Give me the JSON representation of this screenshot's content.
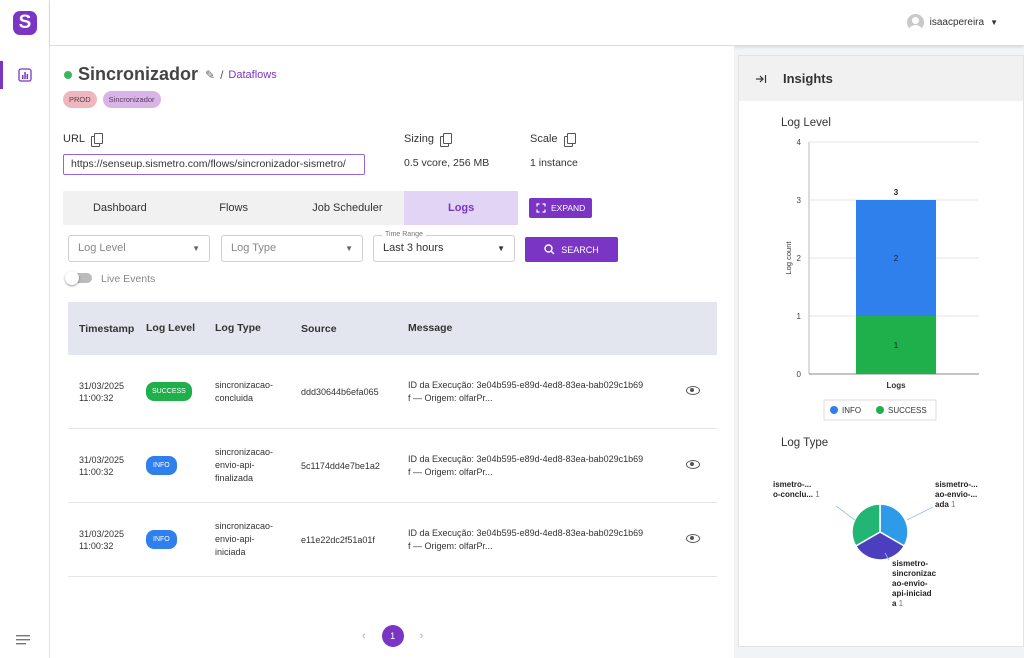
{
  "app": {
    "logo_letter": "S"
  },
  "topbar": {
    "user_name": "isaacpereira"
  },
  "header": {
    "title": "Sincronizador",
    "breadcrumb": "Dataflows",
    "tags": [
      "PROD",
      "Sincronizador"
    ]
  },
  "info": {
    "url_label": "URL",
    "url_value": "https://senseup.sismetro.com/flows/sincronizador-sismetro/",
    "sizing_label": "Sizing",
    "sizing_value": "0.5 vcore, 256 MB",
    "scale_label": "Scale",
    "scale_value": "1 instance"
  },
  "tabs": [
    {
      "label": "Dashboard"
    },
    {
      "label": "Flows"
    },
    {
      "label": "Job Scheduler"
    },
    {
      "label": "Logs",
      "active": true
    }
  ],
  "expand_label": "EXPAND",
  "filters": {
    "log_level_placeholder": "Log Level",
    "log_type_placeholder": "Log Type",
    "time_range_label": "Time Range",
    "time_range_value": "Last 3 hours",
    "search_label": "SEARCH",
    "live_events_label": "Live Events",
    "live_events_on": false
  },
  "table": {
    "headers": [
      "Timestamp",
      "Log Level",
      "Log Type",
      "Source",
      "Message"
    ],
    "rows": [
      {
        "date": "31/03/2025",
        "time": "11:00:32",
        "level": "SUCCESS",
        "type_lines": [
          "sincronizacao-",
          "concluida"
        ],
        "source": "ddd30644b6efa065",
        "msg_lines": [
          "ID da Execução: 3e04b595-e89d-4ed8-83ea-bab029c1b69",
          "f — Origem: olfarPr..."
        ]
      },
      {
        "date": "31/03/2025",
        "time": "11:00:32",
        "level": "INFO",
        "type_lines": [
          "sincronizacao-",
          "envio-api-",
          "finalizada"
        ],
        "source": "5c1174dd4e7be1a2",
        "msg_lines": [
          "ID da Execução: 3e04b595-e89d-4ed8-83ea-bab029c1b69",
          "f — Origem: olfarPr..."
        ]
      },
      {
        "date": "31/03/2025",
        "time": "11:00:32",
        "level": "INFO",
        "type_lines": [
          "sincronizacao-",
          "envio-api-",
          "iniciada"
        ],
        "source": "e11e22dc2f51a01f",
        "msg_lines": [
          "ID da Execução: 3e04b595-e89d-4ed8-83ea-bab029c1b69",
          "f — Origem: olfarPr..."
        ]
      }
    ]
  },
  "pagination": {
    "current": "1",
    "prev": "‹",
    "next": "›"
  },
  "insights": {
    "title": "Insights",
    "log_level_title": "Log Level",
    "log_type_title": "Log Type"
  },
  "colors": {
    "accent": "#7b35c4",
    "info": "#2f80ed",
    "success": "#1fb04c",
    "pie_green": "#22b573",
    "pie_blue": "#2e9be8",
    "pie_indigo": "#4b3fc0"
  },
  "chart_data": [
    {
      "type": "bar",
      "title": "Log Level",
      "categories": [
        "Logs"
      ],
      "series": [
        {
          "name": "SUCCESS",
          "values": [
            1
          ]
        },
        {
          "name": "INFO",
          "values": [
            2
          ]
        }
      ],
      "total_label": "3",
      "stacked": true,
      "ylabel": "Log count",
      "xlabel": "",
      "ylim": [
        0,
        4
      ],
      "yticks": [
        "0",
        "1",
        "2",
        "3",
        "4"
      ],
      "legend": "bottom",
      "grid": true
    },
    {
      "type": "pie",
      "title": "Log Type",
      "slices": [
        {
          "label_lines": [
            "ismetro-...",
            "o-conclu..."
          ],
          "value": 1
        },
        {
          "label_lines": [
            "sismetro-...",
            "ao-envio-...",
            "ada"
          ],
          "value": 1
        },
        {
          "label_lines": [
            "sismetro-",
            "sincronizac",
            "ao-envio-",
            "api-iniciad",
            "a"
          ],
          "value": 1
        }
      ]
    }
  ]
}
